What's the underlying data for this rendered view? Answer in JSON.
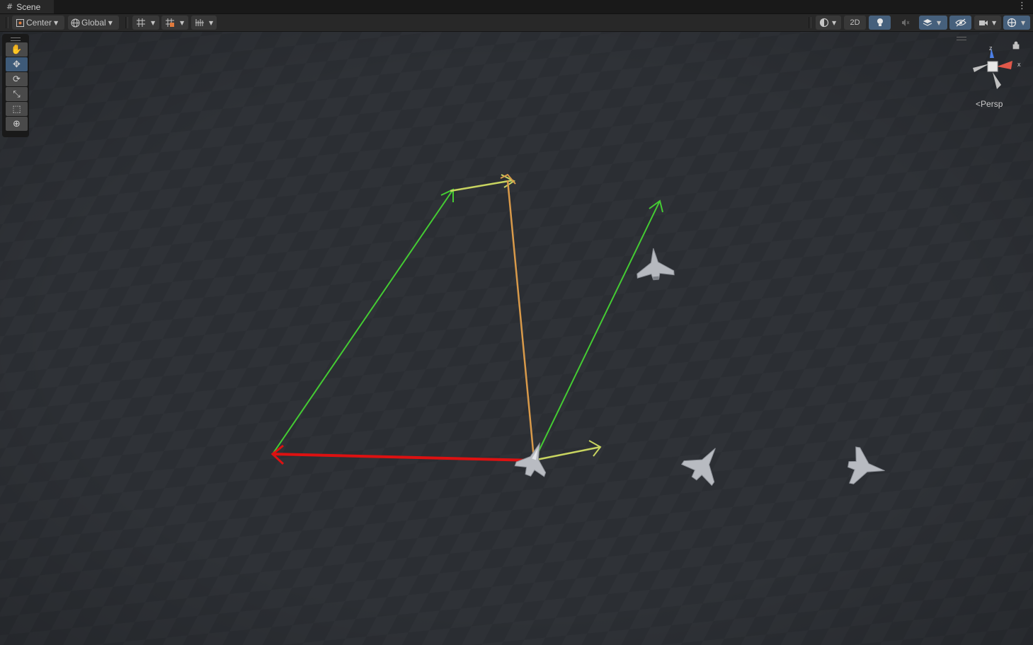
{
  "window": {
    "tab_title": "Scene",
    "tab_icon": "#",
    "menu_icon": "⋮"
  },
  "toolbar": {
    "pivot_label": "Center",
    "space_label": "Global",
    "mode_2d_label": "2D"
  },
  "tools": [
    {
      "name": "view-tool",
      "glyph": "✋"
    },
    {
      "name": "move-tool",
      "glyph": "✥"
    },
    {
      "name": "rotate-tool",
      "glyph": "⟳"
    },
    {
      "name": "scale-tool",
      "glyph": "⤡"
    },
    {
      "name": "rect-tool",
      "glyph": "⬚"
    },
    {
      "name": "transform-tool",
      "glyph": "⊕"
    }
  ],
  "gizmo": {
    "view_label": "Persp",
    "axis_z": "z",
    "axis_x": "x"
  },
  "colors": {
    "viewport_bg": "#2b2e33",
    "selected_button": "#46607c",
    "vector_green": "#44cc33",
    "vector_red": "#dd1111",
    "vector_yellow": "#c8d460",
    "vector_orange": "#d99a4a",
    "axis_x_red": "#e0584a",
    "axis_z_blue": "#4c7fe6"
  }
}
